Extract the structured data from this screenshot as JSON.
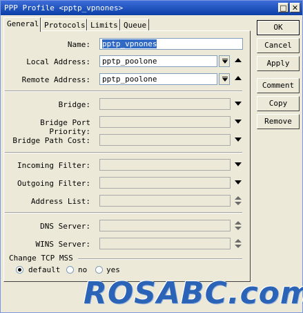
{
  "window": {
    "title": "PPP Profile <pptp_vpnones>"
  },
  "titlebar_buttons": {
    "restore": "□",
    "close": "✕"
  },
  "tabs": [
    {
      "label": "General",
      "active": true
    },
    {
      "label": "Protocols"
    },
    {
      "label": "Limits"
    },
    {
      "label": "Queue"
    }
  ],
  "form": {
    "name": {
      "label": "Name:",
      "value": "pptp_vpnones"
    },
    "local_address": {
      "label": "Local Address:",
      "value": "pptp_poolone"
    },
    "remote_address": {
      "label": "Remote Address:",
      "value": "pptp_poolone"
    },
    "bridge": {
      "label": "Bridge:",
      "value": ""
    },
    "bridge_port_priority": {
      "label": "Bridge Port Priority:",
      "value": ""
    },
    "bridge_path_cost": {
      "label": "Bridge Path Cost:",
      "value": ""
    },
    "incoming_filter": {
      "label": "Incoming Filter:",
      "value": ""
    },
    "outgoing_filter": {
      "label": "Outgoing Filter:",
      "value": ""
    },
    "address_list": {
      "label": "Address List:",
      "value": ""
    },
    "dns_server": {
      "label": "DNS Server:",
      "value": ""
    },
    "wins_server": {
      "label": "WINS Server:",
      "value": ""
    },
    "change_tcp_mss": {
      "label": "Change TCP MSS",
      "options": [
        "default",
        "no",
        "yes"
      ],
      "selected": "default"
    }
  },
  "buttons": {
    "ok": "OK",
    "cancel": "Cancel",
    "apply": "Apply",
    "comment": "Comment",
    "copy": "Copy",
    "remove": "Remove"
  },
  "watermark": "ROSABC.com"
}
